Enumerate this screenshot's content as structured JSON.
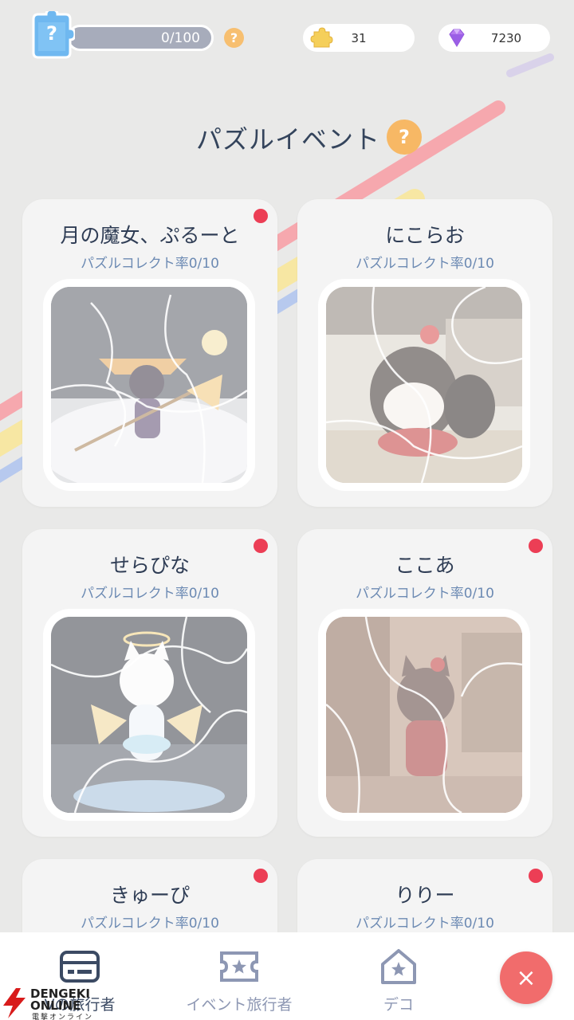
{
  "header": {
    "progress_text": "0/100",
    "help_glyph": "?",
    "coins": "31",
    "gems": "7230",
    "puzzle_badge_glyph": "?"
  },
  "page": {
    "title": "パズルイベント",
    "help_glyph": "?"
  },
  "cards": [
    {
      "name": "月の魔女、ぷるーと",
      "rate": "パズルコレクト率0/10",
      "new": true
    },
    {
      "name": "にこらお",
      "rate": "パズルコレクト率0/10",
      "new": false
    },
    {
      "name": "せらぴな",
      "rate": "パズルコレクト率0/10",
      "new": true
    },
    {
      "name": "ここあ",
      "rate": "パズルコレクト率0/10",
      "new": true
    },
    {
      "name": "きゅーぴ",
      "rate": "パズルコレクト率0/10",
      "new": true
    },
    {
      "name": "りりー",
      "rate": "パズルコレクト率0/10",
      "new": true
    }
  ],
  "nav": {
    "items": [
      {
        "label": "Vの旅行者",
        "icon": "card-icon"
      },
      {
        "label": "イベント旅行者",
        "icon": "ticket-star-icon"
      },
      {
        "label": "デコ",
        "icon": "house-star-icon"
      }
    ],
    "close_glyph": "×"
  },
  "watermark": {
    "line1": "DENGEKI",
    "line2": "ONLINE",
    "sub": "電撃オンライン"
  },
  "colors": {
    "background": "#e9e9e8",
    "card": "#f4f4f4",
    "title_text": "#34445c",
    "rate_text": "#6c8ab3",
    "new_dot": "#ec3e55",
    "help_orange": "#f7b865",
    "close_button": "#f16c6c"
  }
}
